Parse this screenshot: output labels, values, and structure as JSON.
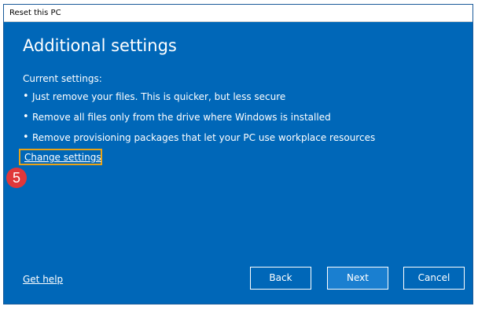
{
  "window": {
    "title": "Reset this PC"
  },
  "main": {
    "heading": "Additional settings",
    "current_label": "Current settings:",
    "bullets": [
      {
        "text": "Just remove your files. This is quicker, but less secure"
      },
      {
        "text": "Remove all files only from the drive where Windows is installed"
      },
      {
        "text": "Remove provisioning packages that let your PC use workplace resources"
      }
    ],
    "bullet_glyph": "•",
    "change_settings_link": "Change settings",
    "step_badge": "5"
  },
  "footer": {
    "help_link": "Get help",
    "back_label": "Back",
    "next_label": "Next",
    "cancel_label": "Cancel"
  },
  "colors": {
    "background": "#0067b8",
    "highlight_box": "#e8a317",
    "badge": "#e0373a"
  }
}
